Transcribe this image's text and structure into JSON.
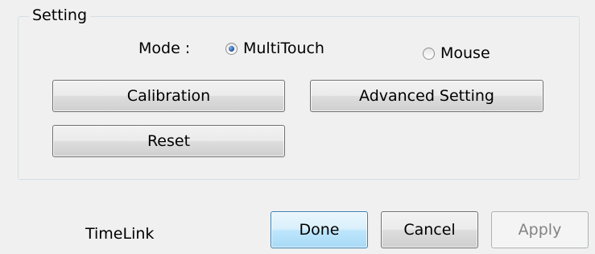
{
  "group": {
    "legend": "Setting"
  },
  "mode": {
    "label": "Mode :",
    "options": [
      {
        "label": "MultiTouch",
        "checked": true
      },
      {
        "label": "Mouse",
        "checked": false
      }
    ]
  },
  "setting_buttons": {
    "calibration": "Calibration",
    "advanced": "Advanced Setting",
    "reset": "Reset"
  },
  "footer": {
    "brand": "TimeLink",
    "done": "Done",
    "cancel": "Cancel",
    "apply": "Apply",
    "apply_enabled": false
  }
}
